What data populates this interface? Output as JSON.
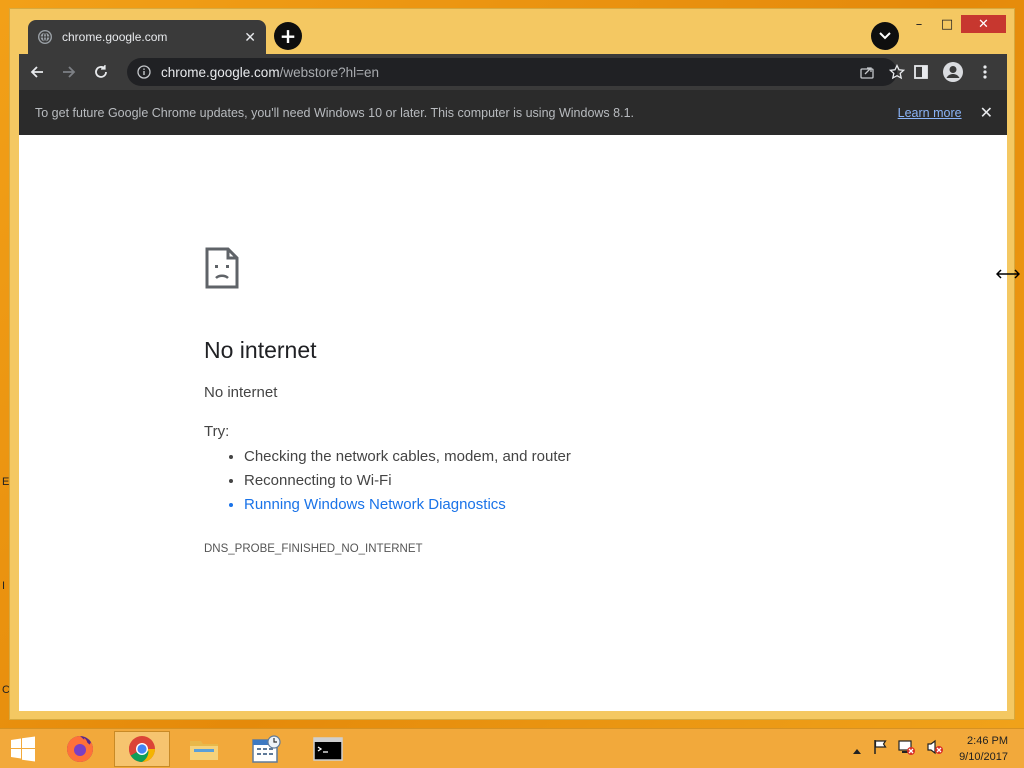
{
  "desktop": {
    "edge_glyphs": [
      "E",
      "I",
      "C"
    ]
  },
  "window": {
    "controls": {
      "minimize": "–",
      "maximize": "□",
      "close": "✕"
    }
  },
  "tab": {
    "title": "chrome.google.com",
    "close": "✕",
    "icon": "globe-icon"
  },
  "toolbar": {
    "new_tab": "+",
    "url_host": "chrome.google.com",
    "url_path": "/webstore?hl=en"
  },
  "infobar": {
    "message": "To get future Google Chrome updates, you'll need Windows 10 or later. This computer is using Windows 8.1.",
    "link": "Learn more",
    "close": "✕"
  },
  "error_page": {
    "title": "No internet",
    "subtitle": "No internet",
    "try_label": "Try:",
    "suggestions": [
      "Checking the network cables, modem, and router",
      "Reconnecting to Wi-Fi",
      "Running Windows Network Diagnostics"
    ],
    "error_code": "DNS_PROBE_FINISHED_NO_INTERNET"
  },
  "taskbar": {
    "apps": [
      "start",
      "firefox",
      "chrome",
      "file-explorer",
      "task-scheduler",
      "command-prompt"
    ],
    "clock_time": "2:46 PM",
    "clock_date": "9/10/2017"
  },
  "colors": {
    "desktop": "#e8890c",
    "frame": "#f4c862",
    "chrome_dark": "#3a3a3a",
    "link_blue": "#1a73e8"
  }
}
